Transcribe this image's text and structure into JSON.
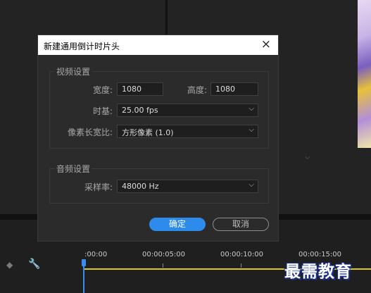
{
  "dialog": {
    "title": "新建通用倒计时片头",
    "close_icon": "×",
    "video_settings": {
      "group_label": "视频设置",
      "width_label": "宽度:",
      "width_value": "1080",
      "height_label": "高度:",
      "height_value": "1080",
      "timebase_label": "时基:",
      "timebase_value": "25.00 fps",
      "pixel_aspect_label": "像素长宽比:",
      "pixel_aspect_value": "方形像素 (1.0)"
    },
    "audio_settings": {
      "group_label": "音频设置",
      "sample_rate_label": "采样率:",
      "sample_rate_value": "48000 Hz"
    },
    "ok_label": "确定",
    "cancel_label": "取消"
  },
  "timeline": {
    "timecodes": [
      ":00:00",
      "00:00:05:00",
      "00:00:10:00",
      "00:00:15:00"
    ]
  },
  "watermark": "最需教育",
  "colors": {
    "accent": "#2d8ceb",
    "playhead": "#3b8cf0",
    "work_area": "#d8c81f"
  }
}
